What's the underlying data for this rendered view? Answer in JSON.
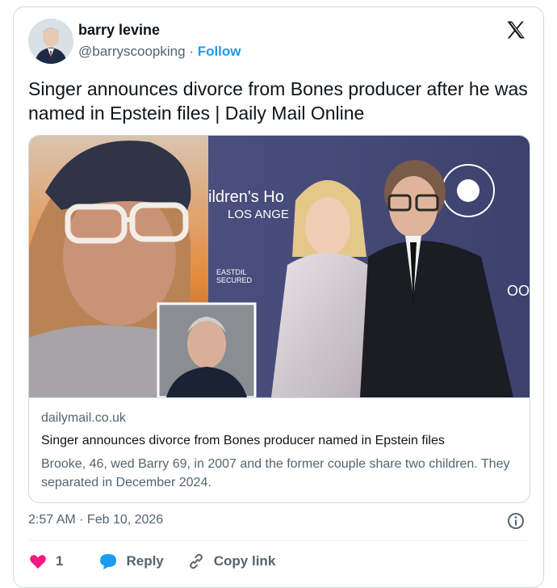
{
  "author": {
    "name": "barry levine",
    "handle": "@barryscoopking",
    "separator": "·",
    "follow_label": "Follow"
  },
  "platform_icon": "x-logo-icon",
  "post_text": "Singer announces divorce from Bones producer after he was named in Epstein files | Daily Mail Online",
  "link_card": {
    "domain": "dailymail.co.uk",
    "title": "Singer announces divorce from Bones producer named in Epstein files",
    "description": "Brooke, 46, wed Barry 69, in 2007 and the former couple share two children. They separated in December 2024."
  },
  "timestamp": "2:57 AM · Feb 10, 2026",
  "actions": {
    "like_count": "1",
    "reply_label": "Reply",
    "copy_link_label": "Copy link"
  },
  "colors": {
    "accent": "#1d9bf0",
    "like": "#f91880",
    "reply": "#1d9bf0",
    "muted": "#536471",
    "border": "#cfd9de"
  }
}
